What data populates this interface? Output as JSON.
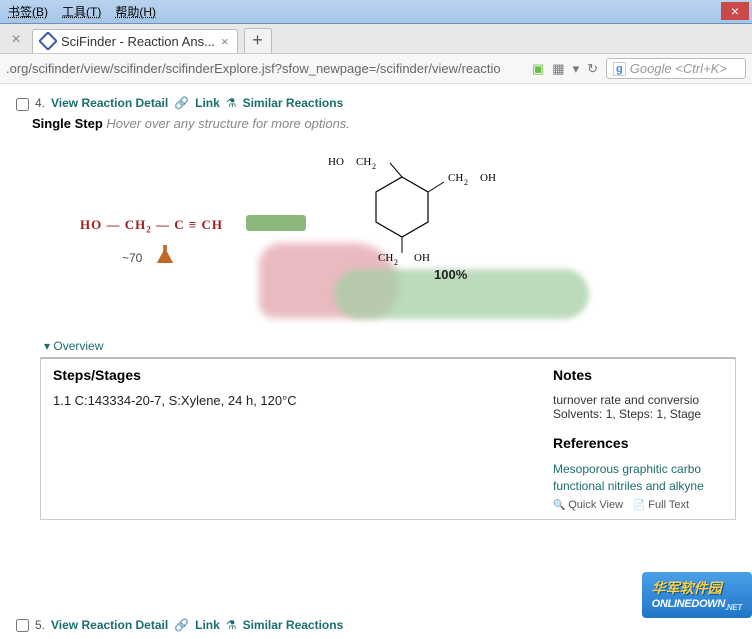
{
  "menu": {
    "bookmarks": "书签(B)",
    "tools": "工具(T)",
    "help": "帮助(H)"
  },
  "tab": {
    "title": "SciFinder - Reaction Ans..."
  },
  "url": ".org/scifinder/view/scifinder/scifinderExplore.jsf?sfow_newpage=/scifinder/view/reactio",
  "search": {
    "placeholder": "Google <Ctrl+K>"
  },
  "result4": {
    "num": "4.",
    "view_detail": "View Reaction Detail",
    "link": "Link",
    "similar": "Similar Reactions"
  },
  "single_step": {
    "label": "Single Step",
    "hint": "Hover over any structure for more options."
  },
  "reaction": {
    "reactant": "HO — CH₂ — C ≡ CH",
    "yield": "~70",
    "percent": "100%"
  },
  "overview_label": "Overview",
  "steps": {
    "header": "Steps/Stages",
    "line": "1.1 C:143334-20-7, S:Xylene, 24 h, 120°C"
  },
  "notes": {
    "header": "Notes",
    "line1": "turnover rate and conversio",
    "line2": "Solvents: 1, Steps: 1, Stage"
  },
  "refs": {
    "header": "References",
    "link1": "Mesoporous graphitic carbo",
    "link2": "functional nitriles and alkyne",
    "quick_view": "Quick View",
    "full_text": "Full Text"
  },
  "result5": {
    "num": "5.",
    "view_detail": "View Reaction Detail",
    "link": "Link",
    "similar": "Similar Reactions"
  },
  "watermark": {
    "cn": "华军软件园",
    "en": "ONLINEDOWN",
    "tld": ".NET"
  }
}
